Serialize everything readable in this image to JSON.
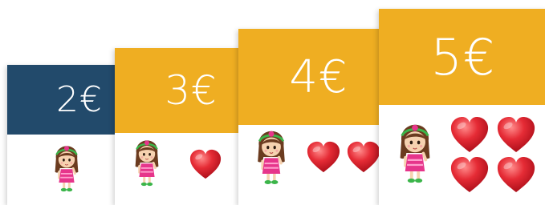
{
  "colors": {
    "dark_header": "#224a6b",
    "gold_header": "#efae22",
    "heart": "#e01e2b"
  },
  "cards": [
    {
      "price": "2€",
      "header_color": "#224a6b",
      "icons": [
        "girl-icon"
      ]
    },
    {
      "price": "3€",
      "header_color": "#efae22",
      "icons": [
        "girl-icon",
        "heart-icon"
      ]
    },
    {
      "price": "4€",
      "header_color": "#efae22",
      "icons": [
        "girl-icon",
        "heart-icon",
        "heart-icon"
      ]
    },
    {
      "price": "5€",
      "header_color": "#efae22",
      "icons": [
        "girl-icon",
        "heart-icon",
        "heart-icon",
        "heart-icon",
        "heart-icon"
      ]
    }
  ]
}
